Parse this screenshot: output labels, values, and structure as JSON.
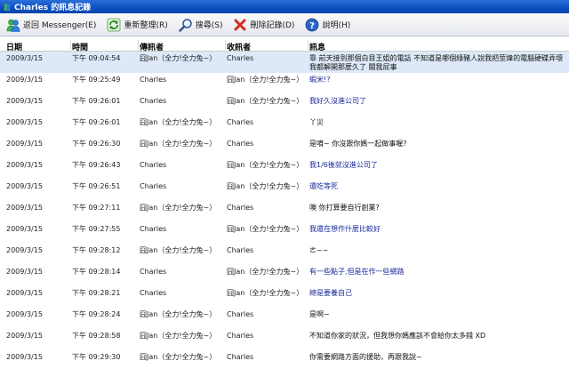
{
  "window": {
    "title": "Charles 的訊息記錄"
  },
  "toolbar": {
    "back_label": "返回 Messenger(E)",
    "refresh_label": "重新整理(R)",
    "search_label": "搜尋(S)",
    "delete_label": "刪除記錄(D)",
    "help_label": "說明(H)"
  },
  "table": {
    "headers": {
      "date": "日期",
      "time": "時間",
      "from": "傳訊者",
      "to": "收訊者",
      "message": "訊息"
    },
    "rows": [
      {
        "date": "2009/3/15",
        "time": "下午 09:04:54",
        "from": "囧Jan（全力!全力兔~）",
        "to": "Charles",
        "message": "靠 前天接到那個白目王姐的電話 不知道是哪個綠豬人說我把莖煒的電腦硬碟弄壞 我都解開那麼久了 關我屁事",
        "selected": true,
        "color": "black"
      },
      {
        "date": "2009/3/15",
        "time": "下午 09:25:49",
        "from": "Charles",
        "to": "囧Jan（全力!全力兔~）",
        "message": "蝦米!?",
        "selected": false,
        "color": "blue"
      },
      {
        "date": "2009/3/15",
        "time": "下午 09:26:01",
        "from": "Charles",
        "to": "囧Jan（全力!全力兔~）",
        "message": "我好久沒進公司了",
        "selected": false,
        "color": "blue"
      },
      {
        "date": "2009/3/15",
        "time": "下午 09:26:01",
        "from": "囧Jan（全力!全力兔~）",
        "to": "Charles",
        "message": "丫災",
        "selected": false,
        "color": "black"
      },
      {
        "date": "2009/3/15",
        "time": "下午 09:26:30",
        "from": "囧Jan（全力!全力兔~）",
        "to": "Charles",
        "message": "是唷~ 你沒跟你媽一起做事喔?",
        "selected": false,
        "color": "black"
      },
      {
        "date": "2009/3/15",
        "time": "下午 09:26:43",
        "from": "Charles",
        "to": "囧Jan（全力!全力兔~）",
        "message": "我1/6後就沒進公司了",
        "selected": false,
        "color": "blue"
      },
      {
        "date": "2009/3/15",
        "time": "下午 09:26:51",
        "from": "Charles",
        "to": "囧Jan（全力!全力兔~）",
        "message": "還吃等死",
        "selected": false,
        "color": "blue"
      },
      {
        "date": "2009/3/15",
        "time": "下午 09:27:11",
        "from": "囧Jan（全力!全力兔~）",
        "to": "Charles",
        "message": "噢 你打算要自行創業?",
        "selected": false,
        "color": "black"
      },
      {
        "date": "2009/3/15",
        "time": "下午 09:27:55",
        "from": "Charles",
        "to": "囧Jan（全力!全力兔~）",
        "message": "我還在想作什麼比較好",
        "selected": false,
        "color": "blue"
      },
      {
        "date": "2009/3/15",
        "time": "下午 09:28:12",
        "from": "囧Jan（全力!全力兔~）",
        "to": "Charles",
        "message": "ㄜ~~",
        "selected": false,
        "color": "black"
      },
      {
        "date": "2009/3/15",
        "time": "下午 09:28:14",
        "from": "Charles",
        "to": "囧Jan（全力!全力兔~）",
        "message": "有一些點子,但是在作一些網路",
        "selected": false,
        "color": "blue"
      },
      {
        "date": "2009/3/15",
        "time": "下午 09:28:21",
        "from": "Charles",
        "to": "囧Jan（全力!全力兔~）",
        "message": "總是要養自己",
        "selected": false,
        "color": "blue"
      },
      {
        "date": "2009/3/15",
        "time": "下午 09:28:24",
        "from": "囧Jan（全力!全力兔~）",
        "to": "Charles",
        "message": "是啊~",
        "selected": false,
        "color": "black"
      },
      {
        "date": "2009/3/15",
        "time": "下午 09:28:58",
        "from": "囧Jan（全力!全力兔~）",
        "to": "Charles",
        "message": "不知道你家的狀況，但我想你媽應該不會給你太多錢 XD",
        "selected": false,
        "color": "black"
      },
      {
        "date": "2009/3/15",
        "time": "下午 09:29:30",
        "from": "囧Jan（全力!全力兔~）",
        "to": "Charles",
        "message": "你需要網路方面的援助，再跟我說~",
        "selected": false,
        "color": "black"
      }
    ]
  },
  "colors": {
    "selected_row": "#dde9f8",
    "sent_blue": "#1a2a9c",
    "titlebar": "#0b4fc0"
  },
  "icons": [
    "app-icon",
    "messenger-people-icon",
    "refresh-icon",
    "magnifier-icon",
    "delete-x-icon",
    "help-icon"
  ]
}
